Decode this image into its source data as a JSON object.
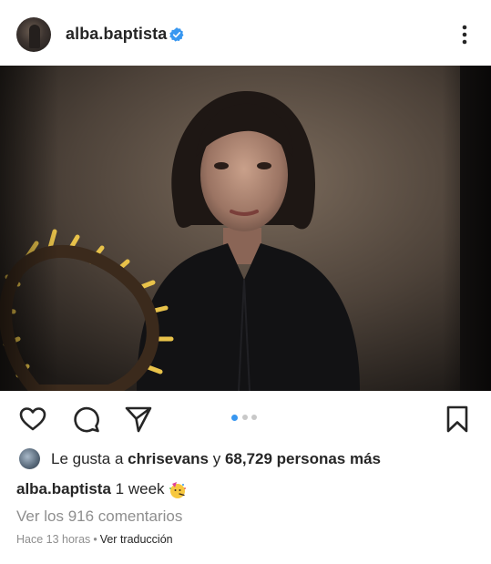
{
  "post": {
    "username": "alba.baptista",
    "verified": true,
    "caption_user": "alba.baptista",
    "caption_text": "1 week",
    "caption_emoji": "party-face",
    "likes_prefix": "Le gusta a",
    "likes_user": "chrisevans",
    "likes_connector": "y",
    "likes_count": "68,729 personas más",
    "comments_link": "Ver los 916 comentarios",
    "timestamp": "Hace 13 horas",
    "separator": "•",
    "translate_link": "Ver traducción"
  },
  "carousel": {
    "total": 3,
    "active_index": 0
  },
  "icons": {
    "like": "heart-icon",
    "comment": "comment-icon",
    "share": "send-icon",
    "save": "bookmark-icon",
    "more": "more-vertical-icon",
    "verified": "verified-badge-icon"
  },
  "colors": {
    "verified_blue": "#3897f0",
    "text": "#262626",
    "muted": "#8e8e8e",
    "carousel_active": "#3897f0",
    "carousel_inactive": "#c8c8c8"
  }
}
